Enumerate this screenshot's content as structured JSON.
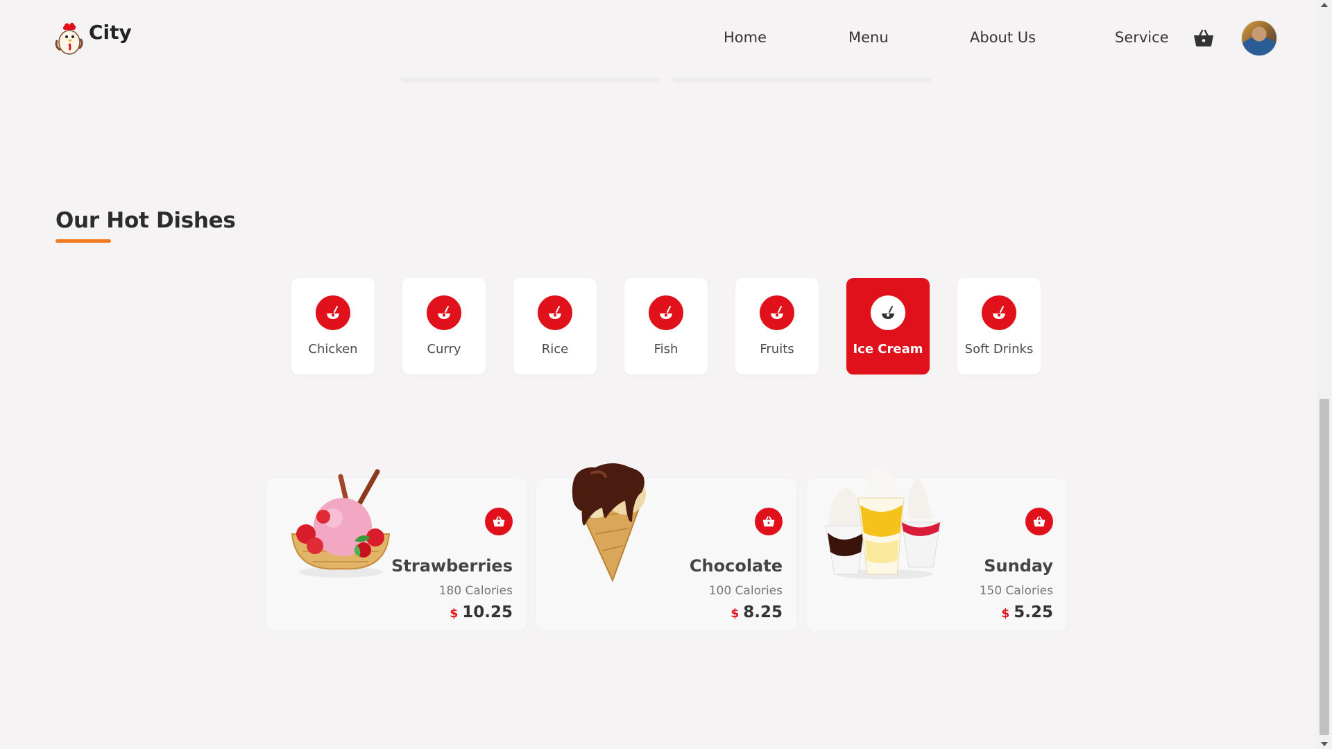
{
  "brand": {
    "name": "City",
    "logo_icon": "chicken-chef-mascot"
  },
  "nav": {
    "items": [
      "Home",
      "Menu",
      "About Us",
      "Service"
    ],
    "cart_icon": "basket-icon",
    "avatar": "user-avatar"
  },
  "section": {
    "title": "Our Hot Dishes",
    "accent_color": "#f07a22"
  },
  "categories": {
    "active": "Ice Cream",
    "items": [
      {
        "label": "Chicken",
        "icon": "dish-icon"
      },
      {
        "label": "Curry",
        "icon": "dish-icon"
      },
      {
        "label": "Rice",
        "icon": "dish-icon"
      },
      {
        "label": "Fish",
        "icon": "dish-icon"
      },
      {
        "label": "Fruits",
        "icon": "dish-icon"
      },
      {
        "label": "Ice Cream",
        "icon": "dish-icon"
      },
      {
        "label": "Soft Drinks",
        "icon": "dish-icon"
      }
    ]
  },
  "dishes": [
    {
      "name": "Strawberries",
      "calories": "180 Calories",
      "currency": "$",
      "price": "10.25",
      "image": "strawberry-ice-cream-bowl"
    },
    {
      "name": "Chocolate",
      "calories": "100 Calories",
      "currency": "$",
      "price": "8.25",
      "image": "chocolate-ice-cream-cone"
    },
    {
      "name": "Sunday",
      "calories": "150 Calories",
      "currency": "$",
      "price": "5.25",
      "image": "sundae-cups"
    }
  ],
  "colors": {
    "primary": "#e0111b",
    "background": "#f5f3f3",
    "card": "#ffffff"
  }
}
